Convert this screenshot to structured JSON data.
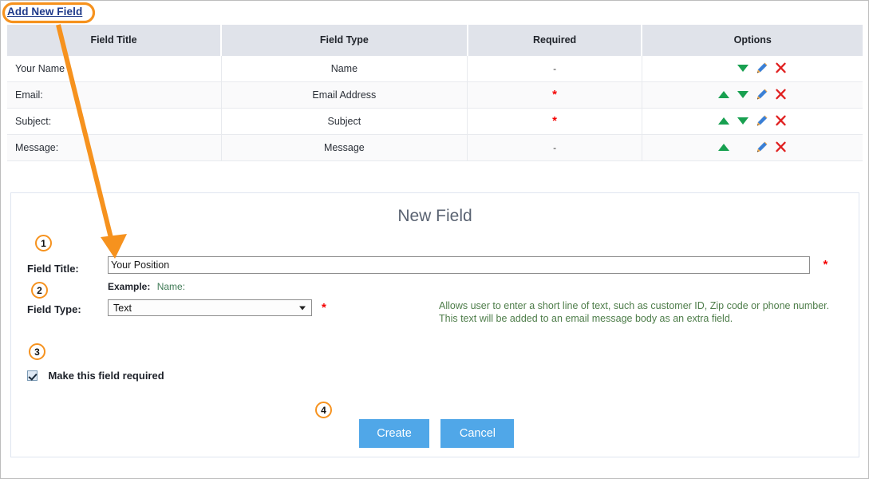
{
  "page": {
    "add_new_field_link": "Add New Field"
  },
  "table": {
    "columns": [
      "Field Title",
      "Field Type",
      "Required",
      "Options"
    ],
    "rows": [
      {
        "title": "Your Name",
        "type": "Name",
        "required": "-",
        "required_is_star": false,
        "options": [
          "move-down-icon",
          "edit-icon",
          "delete-icon"
        ]
      },
      {
        "title": "Email:",
        "type": "Email Address",
        "required": "*",
        "required_is_star": true,
        "options": [
          "move-up-icon",
          "move-down-icon",
          "edit-icon",
          "delete-icon"
        ]
      },
      {
        "title": "Subject:",
        "type": "Subject",
        "required": "*",
        "required_is_star": true,
        "options": [
          "move-up-icon",
          "move-down-icon",
          "edit-icon",
          "delete-icon"
        ]
      },
      {
        "title": "Message:",
        "type": "Message",
        "required": "-",
        "required_is_star": false,
        "options": [
          "move-up-icon",
          "edit-icon",
          "delete-icon"
        ]
      }
    ]
  },
  "form": {
    "title": "New Field",
    "field_title_label": "Field Title:",
    "field_title_value": "Your Position",
    "field_title_required_star": "*",
    "example_label": "Example:",
    "example_value": "Name:",
    "field_type_label": "Field Type:",
    "field_type_value": "Text",
    "field_type_required_star": "*",
    "field_type_description_line1": "Allows user to enter a short line of text, such as customer ID, Zip code or phone number.",
    "field_type_description_line2": "This text will be added to an email message body as an extra field.",
    "required_checkbox_label": "Make this field required",
    "required_checkbox_checked": true,
    "create_button": "Create",
    "cancel_button": "Cancel"
  },
  "annotations": {
    "badges": [
      "1",
      "2",
      "3",
      "4"
    ],
    "highlight_color": "#f6921e",
    "arrow_color": "#f6921e"
  },
  "colors": {
    "link": "#1f3a8a",
    "button_blue": "#50a7e8",
    "table_header": "#e0e3ea",
    "required_red": "#f40000",
    "description_green": "#4e7d4a",
    "annotation_orange": "#f6921e",
    "move_icon_green": "#18a050",
    "delete_icon_red": "#e02020"
  }
}
